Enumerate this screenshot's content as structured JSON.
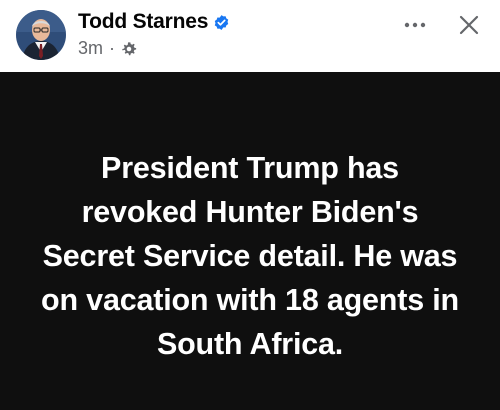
{
  "post": {
    "author": "Todd Starnes",
    "time": "3m",
    "separator": "·",
    "audience_icon": "gear-icon",
    "verified_icon": "verified-badge-icon",
    "text": "President Trump has revoked Hunter Biden's Secret Service detail. He was on vacation with 18 agents in South Africa."
  },
  "colors": {
    "card_background": "#0f0f0f",
    "text": "#ffffff",
    "verified": "#1877f2",
    "muted": "#65676b"
  }
}
